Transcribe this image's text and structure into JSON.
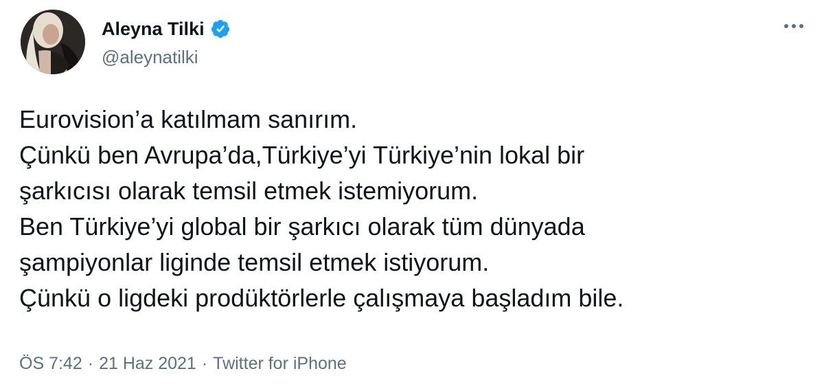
{
  "author": {
    "display_name": "Aleyna Tilki",
    "handle": "@aleynatilki",
    "verified": true,
    "avatar_icon": "profile-photo"
  },
  "tweet": {
    "lines": [
      "Eurovision’a katılmam sanırım.",
      "Çünkü ben Avrupa’da,Türkiye’yi Türkiye’nin lokal bir",
      "şarkıcısı olarak temsil etmek istemiyorum.",
      "Ben Türkiye’yi global bir şarkıcı olarak tüm dünyada",
      "şampiyonlar liginde temsil etmek istiyorum.",
      "Çünkü o ligdeki prodüktörlerle çalışmaya başladım bile."
    ]
  },
  "meta": {
    "time": "ÖS 7:42",
    "separator": "·",
    "date": "21 Haz 2021",
    "source": "Twitter for iPhone"
  },
  "colors": {
    "text": "#0f1419",
    "secondary": "#5b7083",
    "verified": "#1da1f2",
    "background": "#ffffff"
  },
  "icons": {
    "verified": "verified-badge-icon",
    "more": "more-horizontal-icon"
  }
}
